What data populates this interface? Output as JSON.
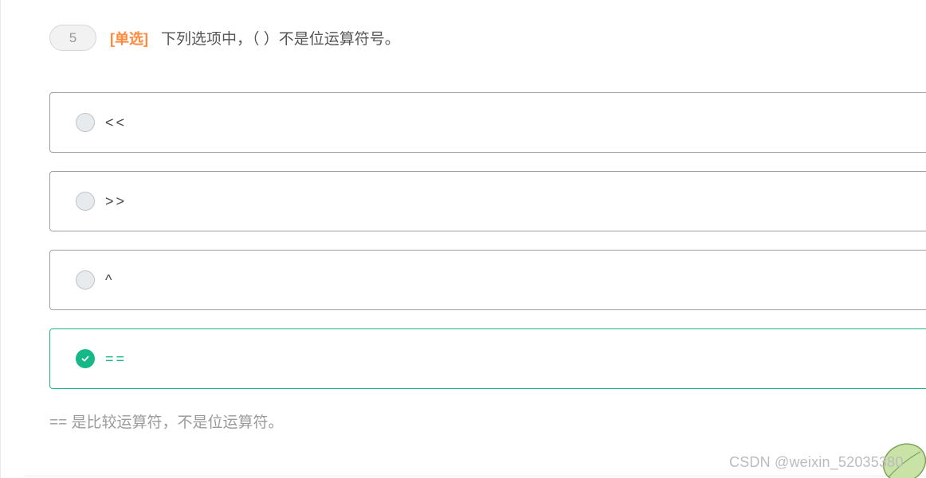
{
  "question": {
    "number": "5",
    "type_label": "[单选]",
    "text": "下列选项中，（ ）不是位运算符号。"
  },
  "options": [
    {
      "label": "<<",
      "selected": false
    },
    {
      "label": ">>",
      "selected": false
    },
    {
      "label": "^",
      "selected": false
    },
    {
      "label": "==",
      "selected": true
    }
  ],
  "explanation": "== 是比较运算符，不是位运算符。",
  "watermark": "CSDN @weixin_52035380",
  "colors": {
    "accent_correct": "#16b888",
    "type_label": "#ff8a3d"
  },
  "icons": {
    "correct_indicator": "check-circle-icon",
    "unselected_indicator": "radio-icon",
    "corner_decoration": "leaf-icon"
  }
}
